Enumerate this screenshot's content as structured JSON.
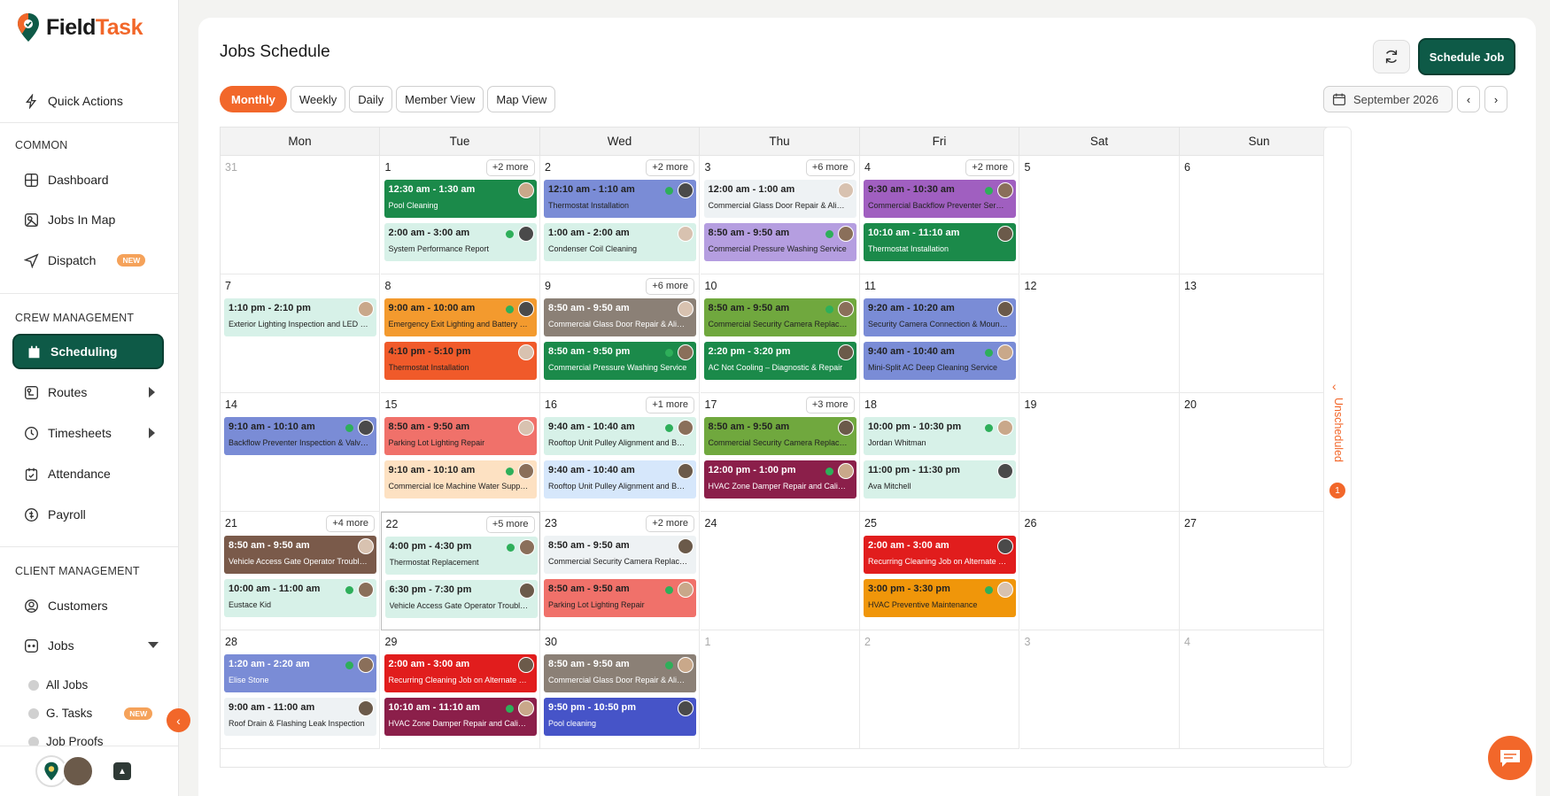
{
  "brand": {
    "name_part1": "Field",
    "name_part2": "Task",
    "accent": "#f2672a",
    "primary": "#0e5a47"
  },
  "sidebar": {
    "quick_actions": "Quick Actions",
    "section_common": "COMMON",
    "dashboard": "Dashboard",
    "jobs_in_map": "Jobs In Map",
    "dispatch": "Dispatch",
    "new_badge": "NEW",
    "section_crew": "CREW MANAGEMENT",
    "scheduling": "Scheduling",
    "routes": "Routes",
    "timesheets": "Timesheets",
    "attendance": "Attendance",
    "payroll": "Payroll",
    "section_client": "CLIENT MANAGEMENT",
    "customers": "Customers",
    "jobs": "Jobs",
    "all_jobs": "All Jobs",
    "g_tasks": "G. Tasks",
    "job_proofs": "Job Proofs"
  },
  "header": {
    "title": "Jobs Schedule",
    "schedule_btn": "Schedule Job"
  },
  "views": [
    "Monthly",
    "Weekly",
    "Daily",
    "Member View",
    "Map View"
  ],
  "active_view": "Monthly",
  "date_label": "September 2026",
  "weekdays": [
    "Mon",
    "Tue",
    "Wed",
    "Thu",
    "Fri",
    "Sat",
    "Sun"
  ],
  "unscheduled": {
    "label": "Unscheduled",
    "count": "1"
  },
  "weeks": [
    {
      "days": [
        {
          "num": "31",
          "dim": true,
          "more": "",
          "events": []
        },
        {
          "num": "1",
          "more": "+2 more",
          "events": [
            {
              "time": "12:30 am - 1:30 am",
              "name": "Pool Cleaning",
              "color": "c1",
              "dark": true
            },
            {
              "time": "2:00 am - 3:00 am",
              "name": "System Performance Report",
              "color": "c2",
              "dark": false
            }
          ]
        },
        {
          "num": "2",
          "more": "+2 more",
          "events": [
            {
              "time": "12:10 am - 1:10 am",
              "name": "Thermostat Installation",
              "color": "c3",
              "dark": false
            },
            {
              "time": "1:00 am - 2:00 am",
              "name": "Condenser Coil Cleaning",
              "color": "c2",
              "dark": false
            }
          ]
        },
        {
          "num": "3",
          "more": "+6 more",
          "events": [
            {
              "time": "12:00 am - 1:00 am",
              "name": "Commercial Glass Door Repair & Align...",
              "color": "c4",
              "dark": false
            },
            {
              "time": "8:50 am - 9:50 am",
              "name": "Commercial Pressure Washing Service",
              "color": "c5",
              "dark": false
            }
          ]
        },
        {
          "num": "4",
          "more": "+2 more",
          "events": [
            {
              "time": "9:30 am - 10:30 am",
              "name": "Commercial Backflow Preventer Service",
              "color": "c6",
              "dark": false
            },
            {
              "time": "10:10 am - 11:10 am",
              "name": "Thermostat Installation",
              "color": "c1",
              "dark": true
            }
          ]
        },
        {
          "num": "5",
          "more": "",
          "events": []
        },
        {
          "num": "6",
          "more": "",
          "events": []
        }
      ]
    },
    {
      "days": [
        {
          "num": "7",
          "more": "",
          "events": [
            {
              "time": "1:10 pm - 2:10 pm",
              "name": "Exterior Lighting Inspection and LED Fix...",
              "color": "c2",
              "dark": false
            }
          ]
        },
        {
          "num": "8",
          "more": "",
          "events": [
            {
              "time": "9:00 am - 10:00 am",
              "name": "Emergency Exit Lighting and Battery Ba...",
              "color": "c7",
              "dark": false
            },
            {
              "time": "4:10 pm - 5:10 pm",
              "name": "Thermostat Installation",
              "color": "c8",
              "dark": false
            }
          ]
        },
        {
          "num": "9",
          "more": "+6 more",
          "events": [
            {
              "time": "8:50 am - 9:50 am",
              "name": "Commercial Glass Door Repair & Align...",
              "color": "c9",
              "dark": true
            },
            {
              "time": "8:50 am - 9:50 pm",
              "name": "Commercial Pressure Washing Service",
              "color": "c1",
              "dark": true
            }
          ]
        },
        {
          "num": "10",
          "more": "",
          "events": [
            {
              "time": "8:50 am - 9:50 am",
              "name": "Commercial Security Camera Replace...",
              "color": "c10",
              "dark": false
            },
            {
              "time": "2:20 pm - 3:20 pm",
              "name": "AC Not Cooling – Diagnostic & Repair",
              "color": "c1",
              "dark": true
            }
          ]
        },
        {
          "num": "11",
          "more": "",
          "events": [
            {
              "time": "9:20 am - 10:20 am",
              "name": "Security Camera Connection & Mountin...",
              "color": "c3",
              "dark": false
            },
            {
              "time": "9:40 am - 10:40 am",
              "name": "Mini-Split AC Deep Cleaning Service",
              "color": "c3",
              "dark": false
            }
          ]
        },
        {
          "num": "12",
          "more": "",
          "events": []
        },
        {
          "num": "13",
          "more": "",
          "events": []
        }
      ]
    },
    {
      "days": [
        {
          "num": "14",
          "more": "",
          "events": [
            {
              "time": "9:10 am - 10:10 am",
              "name": "Backflow Preventer Inspection & Valve R...",
              "color": "c3",
              "dark": false
            }
          ]
        },
        {
          "num": "15",
          "more": "",
          "events": [
            {
              "time": "8:50 am - 9:50 am",
              "name": "Parking Lot Lighting Repair",
              "color": "c11",
              "dark": false
            },
            {
              "time": "9:10 am - 10:10 am",
              "name": "Commercial Ice Machine Water Supply ...",
              "color": "c12",
              "dark": false
            }
          ]
        },
        {
          "num": "16",
          "more": "+1 more",
          "events": [
            {
              "time": "9:40 am - 10:40 am",
              "name": "Rooftop Unit Pulley Alignment and Belt ...",
              "color": "c2",
              "dark": false
            },
            {
              "time": "9:40 am - 10:40 am",
              "name": "Rooftop Unit Pulley Alignment and Belt ...",
              "color": "c13",
              "dark": false
            }
          ]
        },
        {
          "num": "17",
          "more": "+3 more",
          "events": [
            {
              "time": "8:50 am - 9:50 am",
              "name": "Commercial Security Camera Replace...",
              "color": "c10",
              "dark": false
            },
            {
              "time": "12:00 pm - 1:00 pm",
              "name": "HVAC Zone Damper Repair and Calibra...",
              "color": "c14",
              "dark": true
            }
          ]
        },
        {
          "num": "18",
          "more": "",
          "events": [
            {
              "time": "10:00 pm - 10:30 pm",
              "name": "Jordan Whitman",
              "color": "c2",
              "dark": false
            },
            {
              "time": "11:00 pm - 11:30 pm",
              "name": "Ava Mitchell",
              "color": "c2",
              "dark": false
            }
          ]
        },
        {
          "num": "19",
          "more": "",
          "events": []
        },
        {
          "num": "20",
          "more": "",
          "events": []
        }
      ]
    },
    {
      "days": [
        {
          "num": "21",
          "more": "+4 more",
          "events": [
            {
              "time": "8:50 am - 9:50 am",
              "name": "Vehicle Access Gate Operator Troublesh...",
              "color": "c15",
              "dark": true
            },
            {
              "time": "10:00 am - 11:00 am",
              "name": "Eustace Kid",
              "color": "c2",
              "dark": false
            }
          ]
        },
        {
          "num": "22",
          "today": true,
          "more": "+5 more",
          "events": [
            {
              "time": "4:00 pm - 4:30 pm",
              "name": "Thermostat Replacement",
              "color": "c2",
              "dark": false
            },
            {
              "time": "6:30 pm - 7:30 pm",
              "name": "Vehicle Access Gate Operator Troublesh...",
              "color": "c2",
              "dark": false
            }
          ]
        },
        {
          "num": "23",
          "more": "+2 more",
          "events": [
            {
              "time": "8:50 am - 9:50 am",
              "name": "Commercial Security Camera Replace...",
              "color": "c4",
              "dark": false
            },
            {
              "time": "8:50 am - 9:50 am",
              "name": "Parking Lot Lighting Repair",
              "color": "c11",
              "dark": false
            }
          ]
        },
        {
          "num": "24",
          "more": "",
          "events": []
        },
        {
          "num": "25",
          "more": "",
          "events": [
            {
              "time": "2:00 am - 3:00 am",
              "name": "Recurring Cleaning Job on Alternate Fri...",
              "color": "c16",
              "dark": true
            },
            {
              "time": "3:00 pm - 3:30 pm",
              "name": "HVAC Preventive Maintenance",
              "color": "c17",
              "dark": false
            }
          ]
        },
        {
          "num": "26",
          "more": "",
          "events": []
        },
        {
          "num": "27",
          "more": "",
          "events": []
        }
      ]
    },
    {
      "days": [
        {
          "num": "28",
          "more": "",
          "events": [
            {
              "time": "1:20 am - 2:20 am",
              "name": "Elise Stone",
              "color": "c3",
              "dark": true
            },
            {
              "time": "9:00 am - 11:00 am",
              "name": "Roof Drain & Flashing Leak Inspection",
              "color": "c4",
              "dark": false
            }
          ]
        },
        {
          "num": "29",
          "more": "",
          "events": [
            {
              "time": "2:00 am - 3:00 am",
              "name": "Recurring Cleaning Job on Alternate Fri...",
              "color": "c16",
              "dark": true
            },
            {
              "time": "10:10 am - 11:10 am",
              "name": "HVAC Zone Damper Repair and Calibra...",
              "color": "c14",
              "dark": true
            }
          ]
        },
        {
          "num": "30",
          "more": "",
          "events": [
            {
              "time": "8:50 am - 9:50 am",
              "name": "Commercial Glass Door Repair & Align...",
              "color": "c9",
              "dark": true
            },
            {
              "time": "9:50 pm - 10:50 pm",
              "name": "Pool cleaning",
              "color": "c18",
              "dark": true
            }
          ]
        },
        {
          "num": "1",
          "dim": true,
          "more": "",
          "events": []
        },
        {
          "num": "2",
          "dim": true,
          "more": "",
          "events": []
        },
        {
          "num": "3",
          "dim": true,
          "more": "",
          "events": []
        },
        {
          "num": "4",
          "dim": true,
          "more": "",
          "events": []
        }
      ]
    }
  ]
}
